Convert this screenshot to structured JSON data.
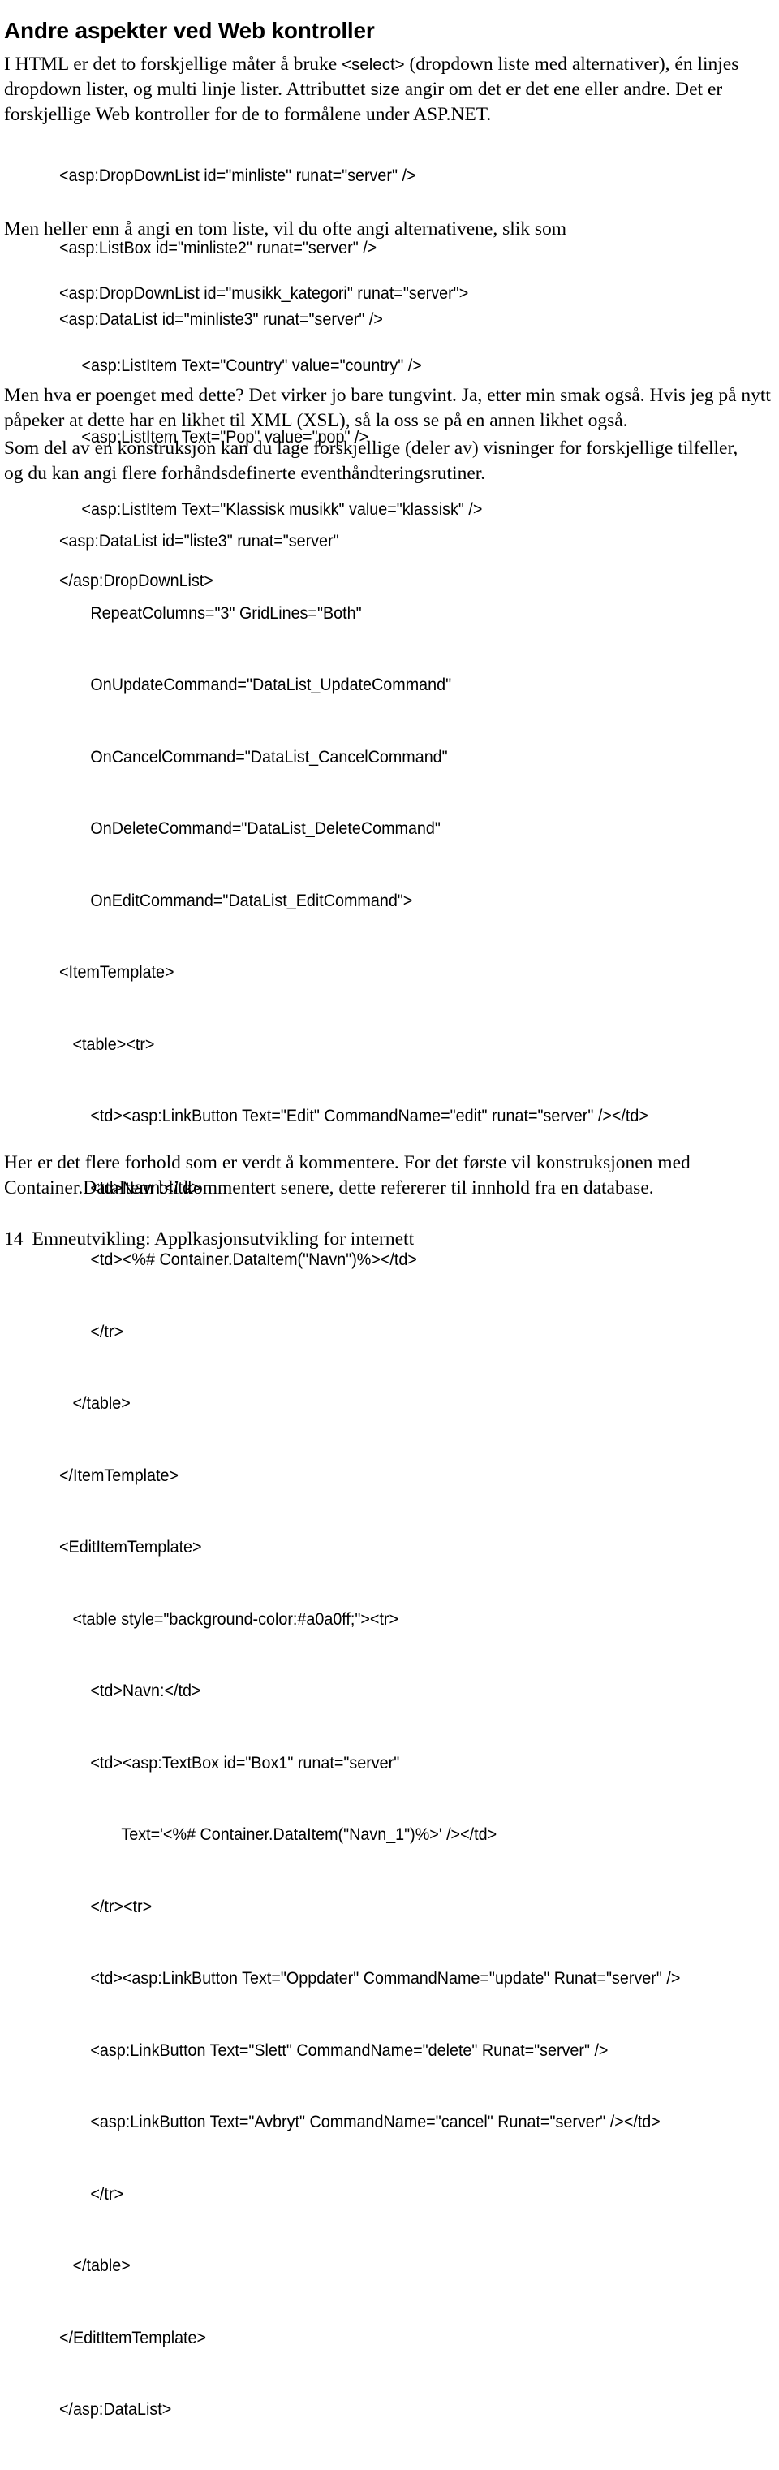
{
  "document": {
    "heading": "Andre aspekter ved Web kontroller",
    "paragraphs": {
      "intro_part1": "I HTML er det to forskjellige måter å bruke ",
      "intro_select": "<select>",
      "intro_part2": " (dropdown liste med alternativer), én linjes dropdown lister, og multi linje lister. Attributtet ",
      "intro_size": "size",
      "intro_part3": " angir om det er det ene eller andre. Det er forskjellige Web kontroller for de to formålene under ASP.NET.",
      "after_first_code": "Men heller enn å angi en tom liste, vil du ofte angi alternativene, slik som",
      "after_second_code": "Men hva er poenget med dette? Det virker jo bare tungvint. Ja, etter min smak også. Hvis jeg på nytt påpeker at dette har en likhet til XML (XSL), så la oss se på en annen likhet også.",
      "before_third_code": "Som del av en konstruksjon kan du lage forskjellige (deler av) visninger for forskjellige tilfeller, og du kan angi flere forhåndsdefinerte eventhåndteringsrutiner.",
      "after_third_code": "Her er det flere forhold som er verdt å kommentere. For det første vil konstruksjonen med Container.DataItem bli kommentert senere, dette refererer til innhold fra en database."
    },
    "code_block_1": [
      "<asp:DropDownList id=\"minliste\" runat=\"server\" />",
      "<asp:ListBox id=\"minliste2\" runat=\"server\" />",
      "<asp:DataList id=\"minliste3\" runat=\"server\" />"
    ],
    "code_block_2": [
      "<asp:DropDownList id=\"musikk_kategori\" runat=\"server\">",
      "     <asp:ListItem Text=\"Country\" value=\"country\" />",
      "     <asp:ListItem Text=\"Pop\" value=\"pop\" />",
      "     <asp:ListItem Text=\"Klassisk musikk\" value=\"klassisk\" />",
      "</asp:DropDownList>"
    ],
    "code_block_3": [
      "<asp:DataList id=\"liste3\" runat=\"server\"",
      "       RepeatColumns=\"3\" GridLines=\"Both\"",
      "       OnUpdateCommand=\"DataList_UpdateCommand\"",
      "       OnCancelCommand=\"DataList_CancelCommand\"",
      "       OnDeleteCommand=\"DataList_DeleteCommand\"",
      "       OnEditCommand=\"DataList_EditCommand\">",
      "<ItemTemplate>",
      "   <table><tr>",
      "       <td><asp:LinkButton Text=\"Edit\" CommandName=\"edit\" runat=\"server\" /></td>",
      "       <td>Navn:</td>",
      "       <td><%# Container.DataItem(\"Navn\")%></td>",
      "       </tr>",
      "   </table>",
      "</ItemTemplate>",
      "<EditItemTemplate>",
      "   <table style=\"background-color:#a0a0ff;\"><tr>",
      "       <td>Navn:</td>",
      "       <td><asp:TextBox id=\"Box1\" runat=\"server\"",
      "              Text='<%# Container.DataItem(\"Navn_1\")%>' /></td>",
      "       </tr><tr>",
      "       <td><asp:LinkButton Text=\"Oppdater\" CommandName=\"update\" Runat=\"server\" />",
      "       <asp:LinkButton Text=\"Slett\" CommandName=\"delete\" Runat=\"server\" />",
      "       <asp:LinkButton Text=\"Avbryt\" CommandName=\"cancel\" Runat=\"server\" /></td>",
      "       </tr>",
      "   </table>",
      "</EditItemTemplate>",
      "</asp:DataList>"
    ],
    "footer": {
      "page_number": "14",
      "course_title": "Emneutvikling: Applkasjonsutvikling for internett"
    }
  }
}
